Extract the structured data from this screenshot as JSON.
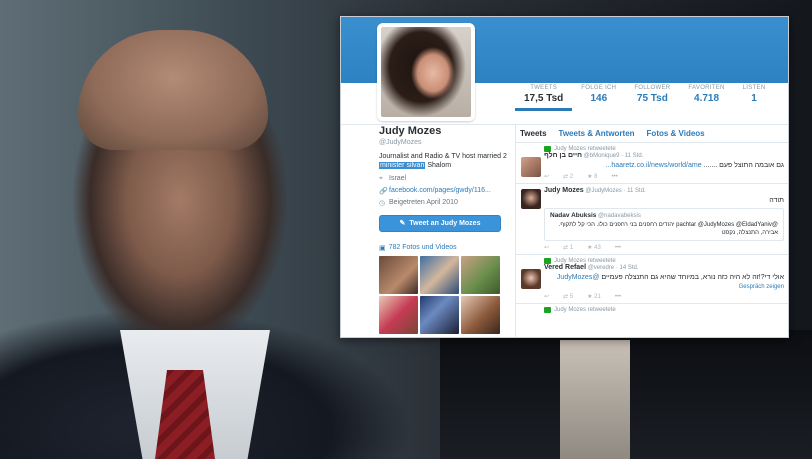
{
  "profile": {
    "name": "Judy Mozes",
    "handle": "@JudyMozes",
    "bio_pre": "Journalist and Radio & TV host married 2",
    "bio_highlight": "minister silvan",
    "bio_post": "Shalom",
    "location": "Israel",
    "website": "facebook.com/pages/gwdy/116...",
    "joined": "Beigetreten April 2010",
    "tweet_button": "Tweet an Judy Mozes",
    "media_link": "782 Fotos und Videos"
  },
  "stats": [
    {
      "label": "TWEETS",
      "value": "17,5 Tsd"
    },
    {
      "label": "FOLGE ICH",
      "value": "146"
    },
    {
      "label": "FOLLOWER",
      "value": "75 Tsd"
    },
    {
      "label": "FAVORITEN",
      "value": "4.718"
    },
    {
      "label": "LISTEN",
      "value": "1"
    }
  ],
  "tabs": [
    "Tweets",
    "Tweets & Antworten",
    "Fotos & Videos"
  ],
  "tweets": [
    {
      "retweet_line": "Judy Mozes retweetete",
      "name": "חיים בן חלף",
      "handle": "@bMonique9",
      "time": "· 11 Std.",
      "body": "גם אובמה התוצל פעם .......",
      "link": "haaretz.co.il/news/world/ame...",
      "retweets": "2",
      "favorites": "8"
    },
    {
      "name": "Judy Mozes",
      "handle": "@JudyMozes",
      "time": "· 11 Std.",
      "body": "תודה",
      "quote_name": "Nadav Abuksis",
      "quote_handle": "@nadavabeksis",
      "quote_body": "@pachtar @JudyMozes @EldadYaniv יהודים רחפנים בני רחפנים כולו. הכי קל לתקוף. אבירה, התנצלה, נקסט",
      "retweets": "1",
      "favorites": "43"
    },
    {
      "retweet_line": "Judy Mozes retweetete",
      "name": "Vered Refael",
      "handle": "@veredre",
      "time": "· 14 Std.",
      "body": "אולי די?!זה לא היה כזה נורא, במיוחד שהיא גם התנצלה פעמיים",
      "mention": "@JudyMozes",
      "convo": "Gespräch zeigen",
      "retweets": "5",
      "favorites": "21"
    },
    {
      "retweet_line": "Judy Mozes retweetete"
    }
  ]
}
